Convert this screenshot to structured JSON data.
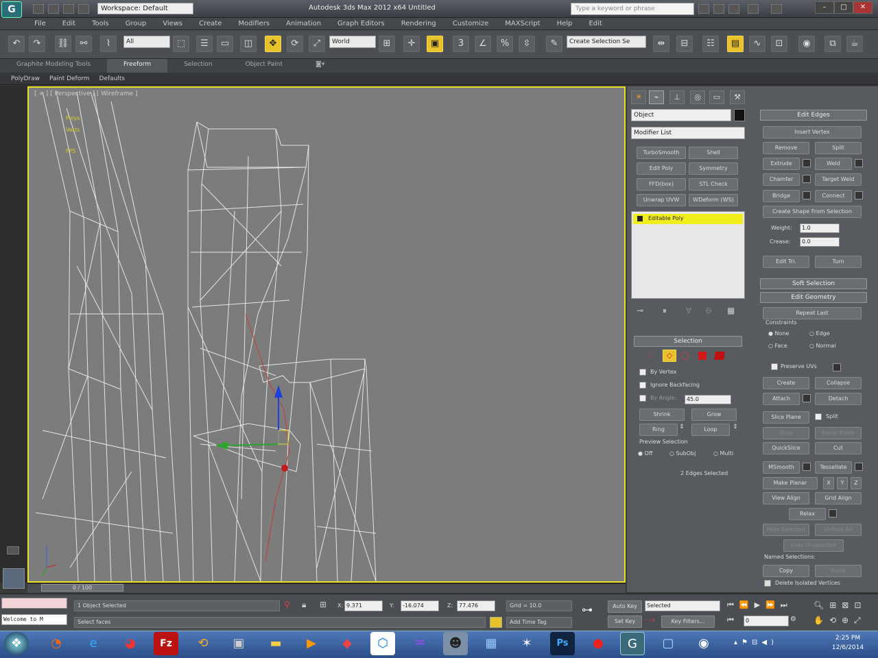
{
  "titlebar": {
    "workspace": "Workspace: Default",
    "app_title": "Autodesk 3ds Max  2012 x64     Untitled",
    "search_placeholder": "Type a keyword or phrase"
  },
  "menu": [
    "File",
    "Edit",
    "Tools",
    "Group",
    "Views",
    "Create",
    "Modifiers",
    "Animation",
    "Graph Editors",
    "Rendering",
    "Customize",
    "MAXScript",
    "Help",
    "Edit"
  ],
  "toolbar": {
    "filter": "All",
    "coord": "World",
    "named_selection": "Create Selection Se"
  },
  "ribbon": {
    "tabs": [
      "Graphite Modeling Tools",
      "Freeform",
      "Selection",
      "Object Paint"
    ],
    "active_tab": "Freeform",
    "sub": [
      "PolyDraw",
      "Paint Deform",
      "Defaults"
    ]
  },
  "viewport": {
    "label": "[ + ] [ Perspective ] [ Wireframe ]",
    "stats": [
      "Polys",
      "Verts",
      "FPS"
    ]
  },
  "command_panel": {
    "object_name": "Object",
    "modifier_list": "Modifier List",
    "modifier_buttons": [
      "TurboSmooth",
      "Shell",
      "Edit Poly",
      "Symmetry",
      "FFD(box)",
      "STL Check",
      "Unwrap UVW",
      "WDeform (WS)"
    ],
    "stack_item": "Editable Poly",
    "selection_rollout": "Selection",
    "by_vertex": "By Vertex",
    "ignore_backfacing": "Ignore Backfacing",
    "by_angle": "By Angle:",
    "by_angle_value": "45.0",
    "shrink": "Shrink",
    "grow": "Grow",
    "ring": "Ring",
    "loop": "Loop",
    "preview_selection": "Preview Selection",
    "preview_options": [
      "Off",
      "SubObj",
      "Multi"
    ],
    "selected_status": "2 Edges Selected"
  },
  "edit_edges": {
    "title": "Edit Edges",
    "insert_vertex": "Insert Vertex",
    "remove": "Remove",
    "split": "Split",
    "extrude": "Extrude",
    "weld": "Weld",
    "chamfer": "Chamfer",
    "target_weld": "Target Weld",
    "bridge": "Bridge",
    "connect": "Connect",
    "create_shape": "Create Shape From Selection",
    "weight_label": "Weight:",
    "weight_value": "1.0",
    "crease_label": "Crease:",
    "crease_value": "0.0",
    "edit_tri": "Edit Tri.",
    "turn": "Turn"
  },
  "soft_selection": "Soft Selection",
  "edit_geometry": {
    "title": "Edit Geometry",
    "repeat_last": "Repeat Last",
    "constraints": "Constraints",
    "none": "None",
    "edge": "Edge",
    "face": "Face",
    "normal": "Normal",
    "preserve_uvs": "Preserve UVs",
    "create": "Create",
    "collapse": "Collapse",
    "attach": "Attach",
    "detach": "Detach",
    "slice_plane": "Slice Plane",
    "split": "Split",
    "slice": "Slice",
    "reset_plane": "Reset Plane",
    "quickslice": "QuickSlice",
    "cut": "Cut",
    "msmooth": "MSmooth",
    "tessellate": "Tessellate",
    "make_planar": "Make Planar",
    "x": "X",
    "y": "Y",
    "z": "Z",
    "view_align": "View Align",
    "grid_align": "Grid Align",
    "relax": "Relax",
    "hide_selected": "Hide Selected",
    "unhide_all": "Unhide All",
    "hide_unselected": "Hide Unselected",
    "named_selections": "Named Selections:",
    "copy": "Copy",
    "paste": "Paste",
    "delete_isolated": "Delete Isolated Vertices"
  },
  "timeline": {
    "slider": "0 / 100"
  },
  "status": {
    "listener": "Welcome to M",
    "objects_selected": "1 Object Selected",
    "prompt": "Select faces",
    "x_label": "X:",
    "x": "9.371",
    "y_label": "Y:",
    "y": "-16.074",
    "z_label": "Z:",
    "z": "77.476",
    "grid": "Grid = 10.0",
    "add_time_tag": "Add Time Tag",
    "auto_key": "Auto Key",
    "selected": "Selected",
    "set_key": "Set Key",
    "key_filters": "Key Filters...",
    "frame": "0"
  },
  "taskbar": {
    "time": "2:25 PM",
    "date": "12/6/2014"
  }
}
